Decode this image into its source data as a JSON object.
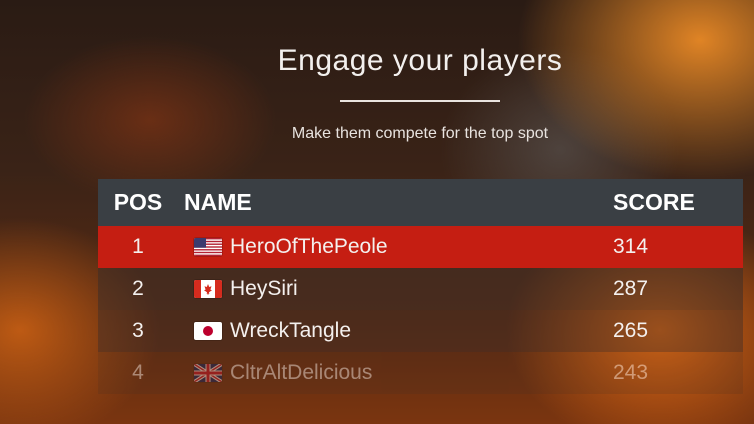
{
  "hero": {
    "title": "Engage your players",
    "subtitle": "Make them compete for the top spot"
  },
  "table": {
    "headers": {
      "pos": "POS",
      "name": "NAME",
      "score": "SCORE"
    },
    "rows": [
      {
        "pos": "1",
        "flag": "us-flag-icon",
        "name": "HeroOfThePeole",
        "score": "314"
      },
      {
        "pos": "2",
        "flag": "ca-flag-icon",
        "name": "HeySiri",
        "score": "287"
      },
      {
        "pos": "3",
        "flag": "jp-flag-icon",
        "name": "WreckTangle",
        "score": "265"
      },
      {
        "pos": "4",
        "flag": "uk-flag-icon",
        "name": "CltrAltDelicious",
        "score": "243"
      }
    ]
  },
  "colors": {
    "highlight_row": "#c51e12",
    "header_bg": "#3a3f44"
  }
}
